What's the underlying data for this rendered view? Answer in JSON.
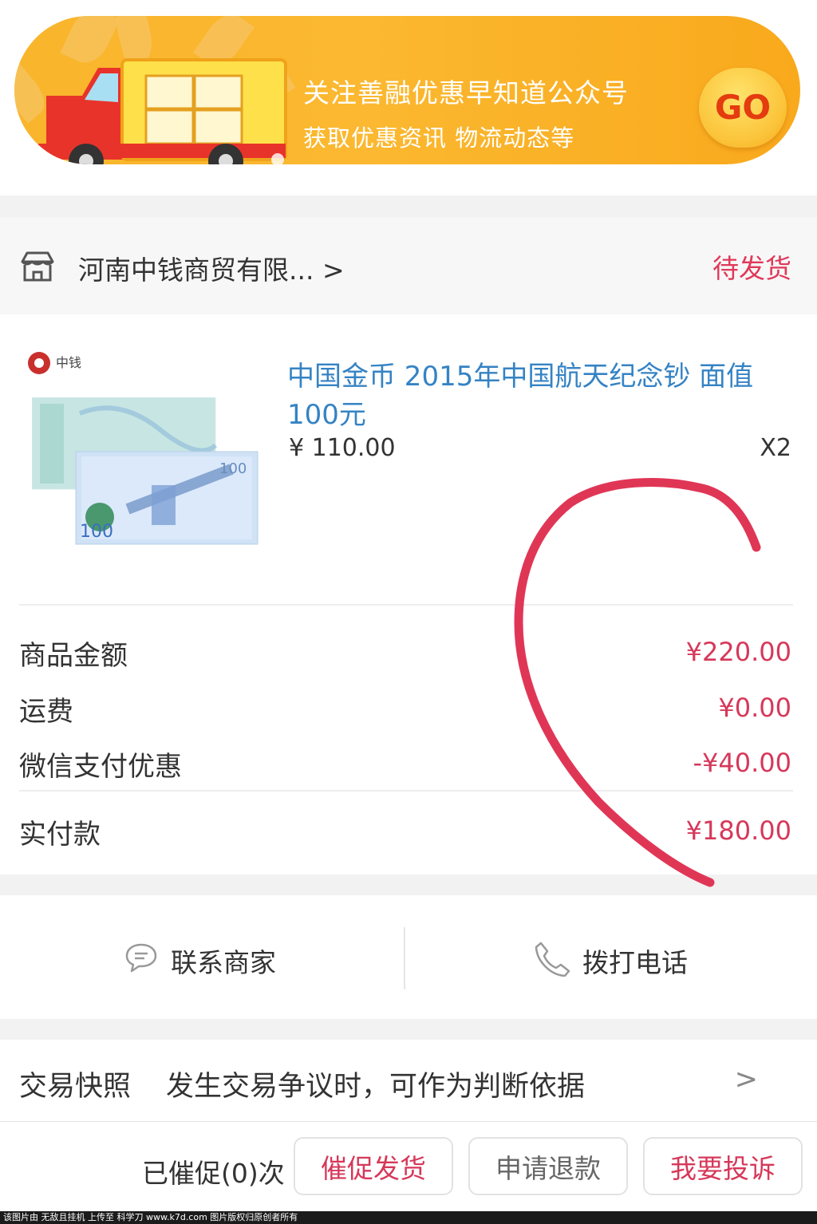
{
  "banner": {
    "line1": "关注善融优惠早知道公众号",
    "line2": "获取优惠资讯 物流动态等",
    "go_label": "GO"
  },
  "shop": {
    "name": "河南中钱商贸有限... >",
    "status": "待发货",
    "status_color": "#e0395a"
  },
  "product": {
    "logo_text": "中钱",
    "title": "中国金币 2015年中国航天纪念钞 面值100元",
    "price": "¥ 110.00",
    "quantity": "X2"
  },
  "summary": {
    "rows": [
      {
        "label": "商品金额",
        "value": "¥220.00"
      },
      {
        "label": "运费",
        "value": "¥0.00"
      },
      {
        "label": "微信支付优惠",
        "value": "-¥40.00"
      }
    ],
    "total_label": "实付款",
    "total_value": "¥180.00",
    "value_color": "#d6385a"
  },
  "actions": {
    "contact_label": "联系商家",
    "call_label": "拨打电话"
  },
  "snapshot": {
    "label": "交易快照",
    "description": "发生交易争议时，可作为判断依据",
    "arrow": ">"
  },
  "bottom_bar": {
    "urge_count_text": "已催促(0)次",
    "urge_button": "催促发货",
    "refund_button": "申请退款",
    "complain_button": "我要投诉"
  },
  "watermark": {
    "text": "该图片由 无敌且挂机 上传至 科学刀 www.k7d.com 图片版权归原创者所有"
  }
}
